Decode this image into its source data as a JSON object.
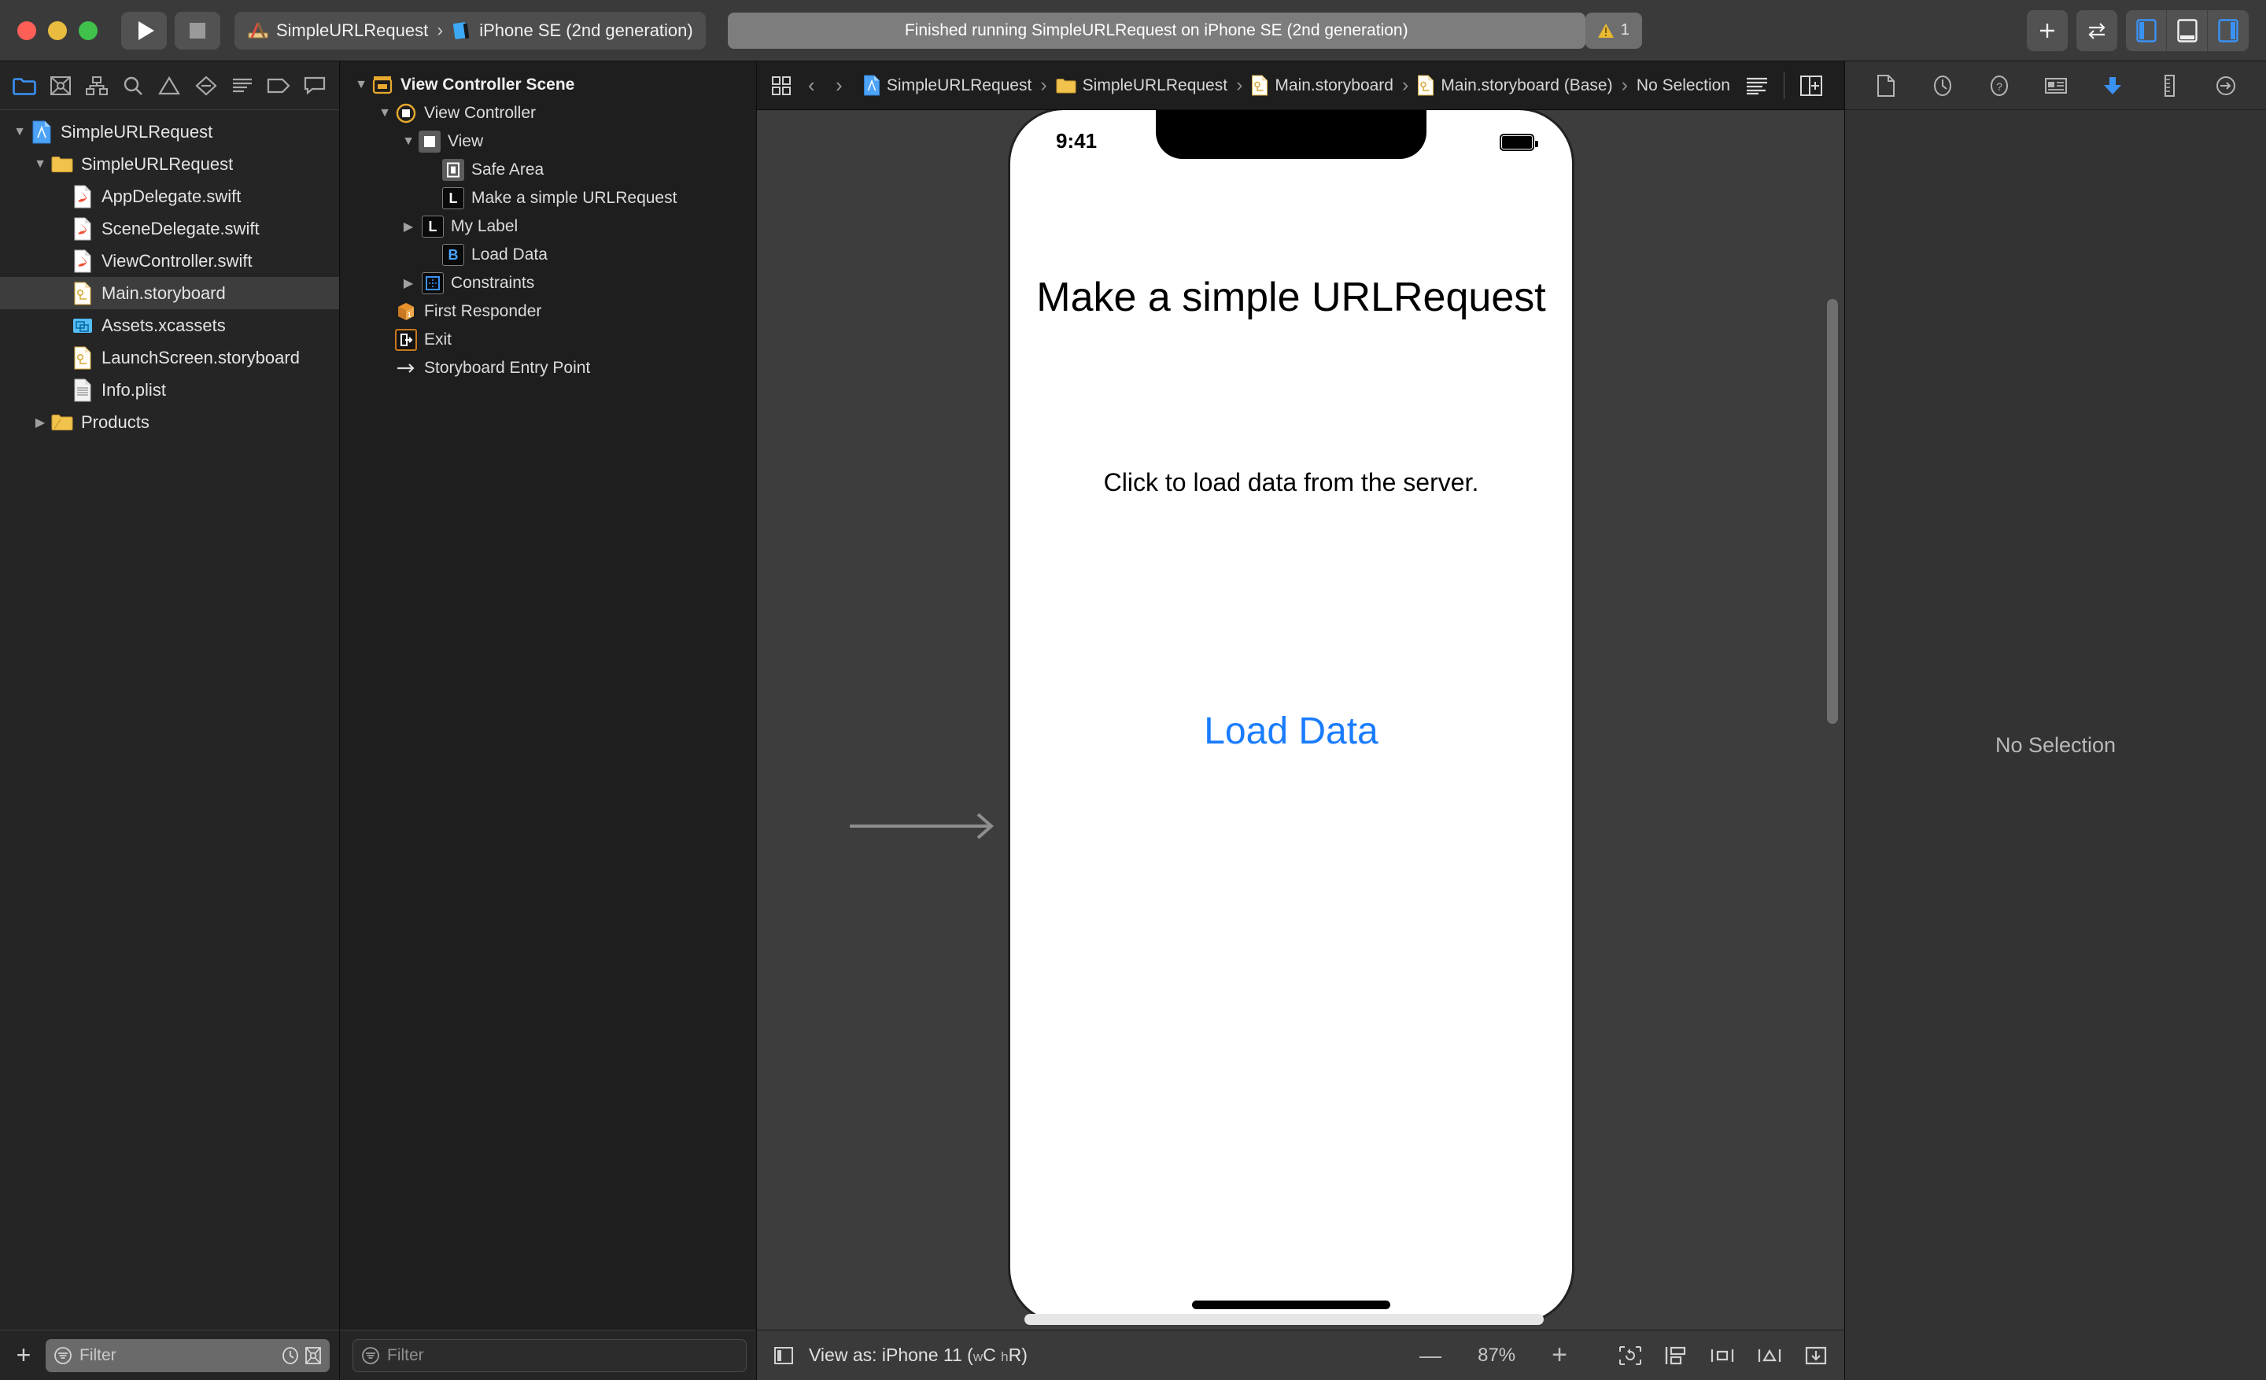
{
  "toolbar": {
    "run_label": "Run",
    "stop_label": "Stop",
    "scheme": {
      "project": "SimpleURLRequest",
      "separator": "›",
      "destination": "iPhone SE (2nd generation)"
    },
    "status_text": "Finished running SimpleURLRequest on iPhone SE (2nd generation)",
    "warning_count": "1",
    "add_label": "+",
    "right_icons": [
      {
        "name": "add-editor-button",
        "glyph": "+"
      },
      {
        "name": "code-review-button",
        "glyph": "⇆"
      },
      {
        "name": "toggle-navigator-button",
        "glyph": "▯"
      },
      {
        "name": "toggle-debug-area-button",
        "glyph": "▭"
      },
      {
        "name": "toggle-inspector-button",
        "glyph": "▯"
      }
    ]
  },
  "navigator": {
    "tabs": [
      {
        "name": "project-navigator-tab",
        "icon": "folder-icon",
        "active": true
      },
      {
        "name": "source-control-navigator-tab",
        "icon": "source-control-icon",
        "active": false
      },
      {
        "name": "symbol-navigator-tab",
        "icon": "hierarchy-icon",
        "active": false
      },
      {
        "name": "find-navigator-tab",
        "icon": "search-icon",
        "active": false
      },
      {
        "name": "issue-navigator-tab",
        "icon": "warning-triangle-icon",
        "active": false
      },
      {
        "name": "test-navigator-tab",
        "icon": "diamond-minus-icon",
        "active": false
      },
      {
        "name": "debug-navigator-tab",
        "icon": "list-lines-icon",
        "active": false
      },
      {
        "name": "breakpoint-navigator-tab",
        "icon": "tag-icon",
        "active": false
      },
      {
        "name": "report-navigator-tab",
        "icon": "speech-bubble-icon",
        "active": false
      }
    ],
    "items": [
      {
        "label": "SimpleURLRequest",
        "icon": "xcode-project-icon",
        "depth": 0,
        "twisty": "down",
        "selected": false
      },
      {
        "label": "SimpleURLRequest",
        "icon": "folder-icon",
        "depth": 1,
        "twisty": "down",
        "selected": false
      },
      {
        "label": "AppDelegate.swift",
        "icon": "swift-file-icon",
        "depth": 2,
        "twisty": "none",
        "selected": false
      },
      {
        "label": "SceneDelegate.swift",
        "icon": "swift-file-icon",
        "depth": 2,
        "twisty": "none",
        "selected": false
      },
      {
        "label": "ViewController.swift",
        "icon": "swift-file-icon",
        "depth": 2,
        "twisty": "none",
        "selected": false
      },
      {
        "label": "Main.storyboard",
        "icon": "storyboard-file-icon",
        "depth": 2,
        "twisty": "none",
        "selected": true
      },
      {
        "label": "Assets.xcassets",
        "icon": "assets-catalog-icon",
        "depth": 2,
        "twisty": "none",
        "selected": false
      },
      {
        "label": "LaunchScreen.storyboard",
        "icon": "storyboard-file-icon",
        "depth": 2,
        "twisty": "none",
        "selected": false
      },
      {
        "label": "Info.plist",
        "icon": "plist-file-icon",
        "depth": 2,
        "twisty": "none",
        "selected": false
      },
      {
        "label": "Products",
        "icon": "folder-icon",
        "depth": 1,
        "twisty": "right",
        "selected": false
      }
    ],
    "filter": {
      "placeholder": "Filter",
      "value": "",
      "recent_icon": "clock-icon",
      "source-control-icon": "source-control-icon"
    }
  },
  "outline": {
    "items": [
      {
        "label": "View Controller Scene",
        "badge": "scene-icon",
        "depth": 0,
        "twisty": "down",
        "bold": true
      },
      {
        "label": "View Controller",
        "badge": "view-controller-icon",
        "depth": 1,
        "twisty": "down",
        "bold": false
      },
      {
        "label": "View",
        "badge": "view-icon",
        "depth": 2,
        "twisty": "down",
        "bold": false
      },
      {
        "label": "Safe Area",
        "badge": "safe-area-icon",
        "depth": 3,
        "twisty": "none",
        "bold": false
      },
      {
        "label": "Make a simple URLRequest",
        "badge": "L",
        "depth": 3,
        "twisty": "none",
        "bold": false
      },
      {
        "label": "My Label",
        "badge": "L",
        "depth": 3,
        "twisty": "right",
        "bold": false
      },
      {
        "label": "Load Data",
        "badge": "B",
        "depth": 3,
        "twisty": "none",
        "bold": false
      },
      {
        "label": "Constraints",
        "badge": "constraints-icon",
        "depth": 2,
        "twisty": "right",
        "bold": false
      },
      {
        "label": "First Responder",
        "badge": "first-responder-icon",
        "depth": 1,
        "twisty": "none",
        "bold": false
      },
      {
        "label": "Exit",
        "badge": "exit-icon",
        "depth": 1,
        "twisty": "none",
        "bold": false
      },
      {
        "label": "Storyboard Entry Point",
        "badge": "entry-point-icon",
        "depth": 1,
        "twisty": "none",
        "bold": false
      }
    ],
    "filter": {
      "placeholder": "Filter",
      "value": ""
    }
  },
  "editor": {
    "breadcrumb": [
      {
        "label": "SimpleURLRequest",
        "icon": "xcode-project-icon"
      },
      {
        "label": "SimpleURLRequest",
        "icon": "folder-icon"
      },
      {
        "label": "Main.storyboard",
        "icon": "storyboard-file-icon"
      },
      {
        "label": "Main.storyboard (Base)",
        "icon": "storyboard-file-icon"
      },
      {
        "label": "No Selection",
        "icon": "none"
      }
    ],
    "separator": "›",
    "right_icons": [
      {
        "name": "minimap-button",
        "glyph": "lines-icon"
      },
      {
        "name": "add-assistant-editor-button",
        "glyph": "add-editor-icon"
      }
    ]
  },
  "phone": {
    "status_time": "9:41",
    "title": "Make a simple URLRequest",
    "subtitle": "Click to load data from the server.",
    "button": "Load Data"
  },
  "canvas_bar": {
    "view_as_prefix": "View as: iPhone 11 (",
    "view_as_wc": "w",
    "view_as_wc_val": "C",
    "view_as_hr": "h",
    "view_as_hr_val": "R",
    "view_as_suffix": ")",
    "zoom_out": "—",
    "zoom_level": "87%",
    "zoom_in": "+",
    "tools": [
      {
        "name": "update-frames-button",
        "glyph": "update-frames-icon"
      },
      {
        "name": "embed-in-button",
        "glyph": "embed-icon"
      },
      {
        "name": "align-button",
        "glyph": "align-icon"
      },
      {
        "name": "add-new-constraints-button",
        "glyph": "constraints-icon"
      },
      {
        "name": "resolve-auto-layout-issues-button",
        "glyph": "resolve-icon"
      }
    ]
  },
  "inspector": {
    "tabs": [
      {
        "name": "file-inspector-tab",
        "icon": "document-icon",
        "active": false
      },
      {
        "name": "history-inspector-tab",
        "icon": "clock-icon",
        "active": false
      },
      {
        "name": "quick-help-inspector-tab",
        "icon": "question-mark-icon",
        "active": false
      },
      {
        "name": "identity-inspector-tab",
        "icon": "id-card-icon",
        "active": false
      },
      {
        "name": "attributes-inspector-tab",
        "icon": "down-arrow-icon",
        "active": true
      },
      {
        "name": "size-inspector-tab",
        "icon": "ruler-icon",
        "active": false
      },
      {
        "name": "connections-inspector-tab",
        "icon": "arrow-right-circle-icon",
        "active": false
      }
    ],
    "empty_state": "No Selection"
  },
  "colors": {
    "accent": "#3b92f5",
    "button_blue": "#1a7cff",
    "warning": "#e8b931",
    "window_bg": "#292929",
    "navigator_bg": "#252526",
    "canvas_bg": "#3d3d3d"
  }
}
